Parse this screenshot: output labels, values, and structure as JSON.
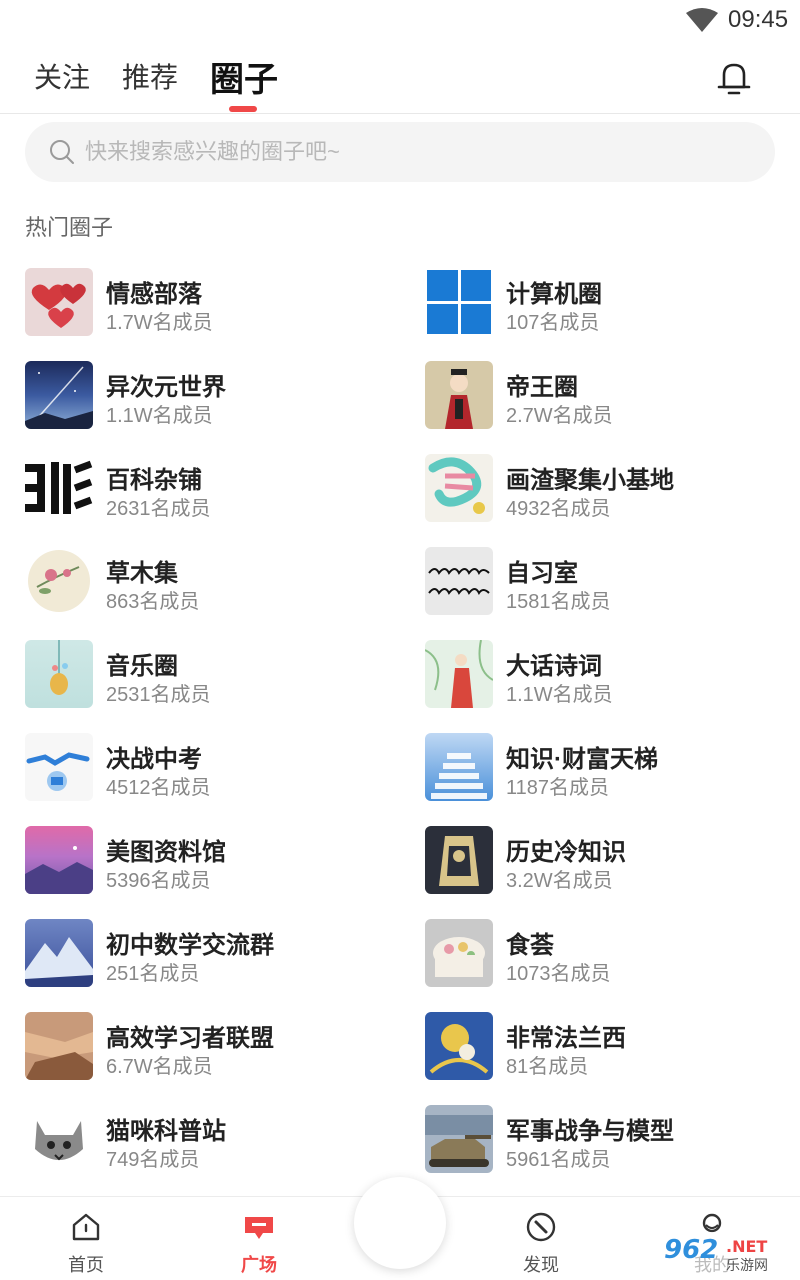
{
  "status": {
    "time": "09:45"
  },
  "tabs": [
    {
      "label": "关注"
    },
    {
      "label": "推荐"
    },
    {
      "label": "圈子"
    }
  ],
  "search": {
    "placeholder": "快来搜索感兴趣的圈子吧~"
  },
  "section_title": "热门圈子",
  "circles": [
    {
      "name": "情感部落",
      "members": "1.7W名成员",
      "icon": "hearts-thumb"
    },
    {
      "name": "计算机圈",
      "members": "107名成员",
      "icon": "windows-logo-thumb"
    },
    {
      "name": "异次元世界",
      "members": "1.1W名成员",
      "icon": "starry-sky-thumb"
    },
    {
      "name": "帝王圈",
      "members": "2.7W名成员",
      "icon": "emperor-thumb"
    },
    {
      "name": "百科杂铺",
      "members": "2631名成员",
      "icon": "calligraphy-thumb"
    },
    {
      "name": "画渣聚集小基地",
      "members": "4932名成员",
      "icon": "colorful-text-thumb"
    },
    {
      "name": "草木集",
      "members": "863名成员",
      "icon": "flower-painting-thumb"
    },
    {
      "name": "自习室",
      "members": "1581名成员",
      "icon": "handwriting-thumb"
    },
    {
      "name": "音乐圈",
      "members": "2531名成员",
      "icon": "music-illustration-thumb"
    },
    {
      "name": "大话诗词",
      "members": "1.1W名成员",
      "icon": "poet-thumb"
    },
    {
      "name": "决战中考",
      "members": "4512名成员",
      "icon": "exam-thumb"
    },
    {
      "name": "知识·财富天梯",
      "members": "1187名成员",
      "icon": "stairs-thumb"
    },
    {
      "name": "美图资料馆",
      "members": "5396名成员",
      "icon": "purple-landscape-thumb"
    },
    {
      "name": "历史冷知识",
      "members": "3.2W名成员",
      "icon": "history-art-thumb"
    },
    {
      "name": "初中数学交流群",
      "members": "251名成员",
      "icon": "snowy-mountain-thumb"
    },
    {
      "name": "食荟",
      "members": "1073名成员",
      "icon": "cake-thumb"
    },
    {
      "name": "高效学习者联盟",
      "members": "6.7W名成员",
      "icon": "hands-thumb"
    },
    {
      "name": "非常法兰西",
      "members": "81名成员",
      "icon": "painting-thumb"
    },
    {
      "name": "猫咪科普站",
      "members": "749名成员",
      "icon": "cat-thumb"
    },
    {
      "name": "军事战争与模型",
      "members": "5961名成员",
      "icon": "tank-thumb"
    }
  ],
  "bottom_nav": [
    {
      "label": "首页",
      "icon": "home-icon"
    },
    {
      "label": "广场",
      "icon": "plaza-icon"
    },
    {
      "label": "发现",
      "icon": "compass-icon"
    },
    {
      "label": "我的",
      "icon": "profile-icon"
    }
  ],
  "colors": {
    "accent": "#f04848",
    "text": "#222222",
    "subtext": "#888888"
  }
}
